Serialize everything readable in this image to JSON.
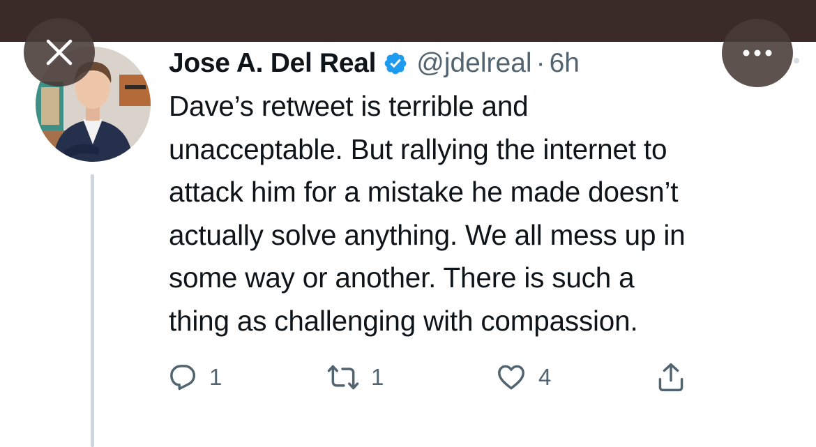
{
  "tweet": {
    "author_name": "Jose A. Del Real",
    "handle": "@jdelreal",
    "separator": "·",
    "time": "6h",
    "text": "Dave’s retweet is terrible and\nunacceptable. But rallying the internet to\nattack him for a mistake he made doesn’t\nactually solve anything. We all mess up in\nsome way or another. There is such a\nthing as challenging with compassion.",
    "verified": true
  },
  "actions": {
    "reply_count": "1",
    "retweet_count": "1",
    "like_count": "4"
  },
  "icons": {
    "close": "close-icon",
    "more": "more-icon",
    "verified": "verified-badge-icon",
    "reply": "reply-icon",
    "retweet": "retweet-icon",
    "like": "heart-icon",
    "share": "share-icon"
  },
  "colors": {
    "top_bar": "#3a2b28",
    "overlay_button": "#483a37",
    "verified_blue": "#1d9bf0",
    "text_primary": "#0f1419",
    "text_secondary": "#536471",
    "thread_line": "#cfd6dc"
  }
}
